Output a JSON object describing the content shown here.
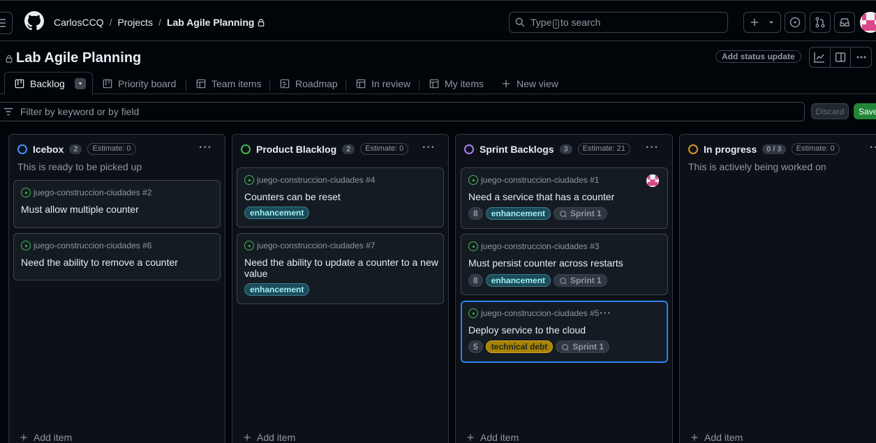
{
  "header": {
    "breadcrumb": [
      "CarlosCCQ",
      "Projects",
      "Lab Agile Planning"
    ],
    "search_before": "Type",
    "search_key": "/",
    "search_after": "to search"
  },
  "project": {
    "title": "Lab Agile Planning",
    "status_update": "Add status update"
  },
  "tabs": [
    {
      "label": "Backlog",
      "icon": "board-icon",
      "active": true
    },
    {
      "label": "Priority board",
      "icon": "board-icon"
    },
    {
      "label": "Team items",
      "icon": "table-icon"
    },
    {
      "label": "Roadmap",
      "icon": "roadmap-icon"
    },
    {
      "label": "In review",
      "icon": "table-icon"
    },
    {
      "label": "My items",
      "icon": "table-icon"
    },
    {
      "label": "New view",
      "icon": "plus-icon"
    }
  ],
  "filter": {
    "placeholder": "Filter by keyword or by field",
    "discard": "Discard",
    "save": "Save"
  },
  "columns": [
    {
      "name": "Icebox",
      "count": "2",
      "estimate": "Estimate: 0",
      "color": "#4493f8",
      "description": "This is ready to be picked up",
      "add_item": "Add item",
      "cards": [
        {
          "repo": "juego-construccion-ciudades #2",
          "title": "Must allow multiple counter"
        },
        {
          "repo": "juego-construccion-ciudades #6",
          "title": "Need the ability to remove a counter"
        }
      ]
    },
    {
      "name": "Product Blacklog",
      "count": "2",
      "estimate": "Estimate: 0",
      "color": "#3fb950",
      "description": "",
      "add_item": "Add item",
      "cards": [
        {
          "repo": "juego-construccion-ciudades #4",
          "title": "Counters can be reset",
          "labels": [
            "enhancement"
          ]
        },
        {
          "repo": "juego-construccion-ciudades #7",
          "title_line1": "Need the ability to update a counter to a new",
          "title_line2": "value",
          "labels": [
            "enhancement"
          ]
        }
      ]
    },
    {
      "name": "Sprint Backlogs",
      "count": "3",
      "estimate": "Estimate: 21",
      "color": "#ab7df8",
      "description": "",
      "add_item": "Add item",
      "cards": [
        {
          "repo": "juego-construccion-ciudades #1",
          "title": "Need a service that has a counter",
          "estimate": "8",
          "labels": [
            "enhancement"
          ],
          "sprint": "Sprint 1"
        },
        {
          "repo": "juego-construccion-ciudades #3",
          "title": "Must persist counter across restarts",
          "estimate": "8",
          "labels": [
            "enhancement"
          ],
          "sprint": "Sprint 1"
        },
        {
          "repo": "juego-construccion-ciudades #5",
          "title": "Deploy service to the cloud",
          "estimate": "5",
          "labels": [
            "technical debt"
          ],
          "sprint": "Sprint 1"
        }
      ]
    },
    {
      "name": "In progress",
      "count": "0 / 3",
      "estimate": "Estimate: 0",
      "color": "#d29922",
      "description": "This is actively being worked on",
      "add_item": "Add item",
      "cards": []
    }
  ]
}
